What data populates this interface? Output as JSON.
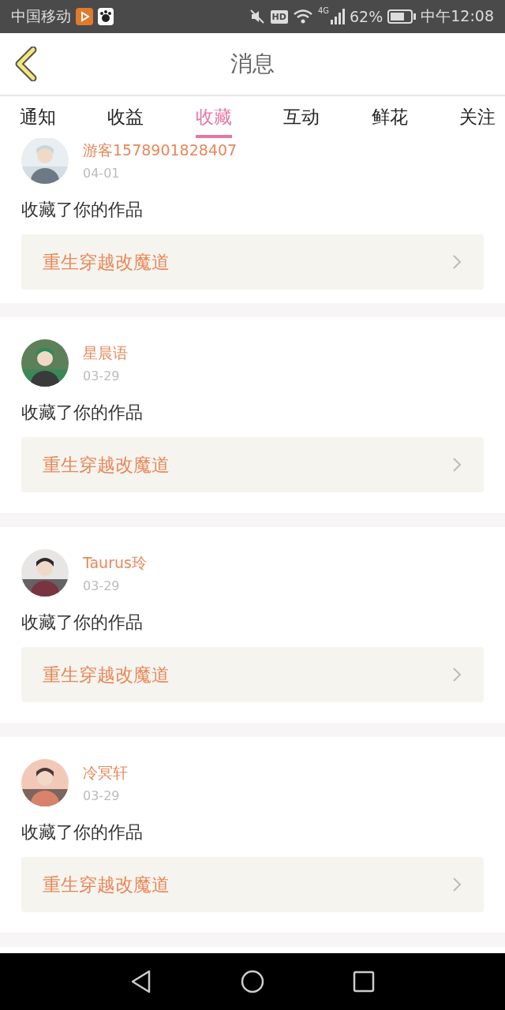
{
  "status_bar": {
    "carrier": "中国移动",
    "hd": "HD",
    "network": "4G",
    "battery": "62%",
    "time": "中午12:08"
  },
  "header": {
    "title": "消息"
  },
  "tabs": [
    {
      "label": "通知",
      "selected": false
    },
    {
      "label": "收益",
      "selected": false
    },
    {
      "label": "收藏",
      "selected": true
    },
    {
      "label": "互动",
      "selected": false
    },
    {
      "label": "鲜花",
      "selected": false
    },
    {
      "label": "关注",
      "selected": false
    }
  ],
  "messages": [
    {
      "user": "游客1578901828407",
      "date": "04-01",
      "action": "收藏了你的作品",
      "work_title": "重生穿越改魔道"
    },
    {
      "user": "星晨语",
      "date": "03-29",
      "action": "收藏了你的作品",
      "work_title": "重生穿越改魔道"
    },
    {
      "user": "Taurus玲",
      "date": "03-29",
      "action": "收藏了你的作品",
      "work_title": "重生穿越改魔道"
    },
    {
      "user": "冷冥轩",
      "date": "03-29",
      "action": "收藏了你的作品",
      "work_title": "重生穿越改魔道"
    }
  ]
}
